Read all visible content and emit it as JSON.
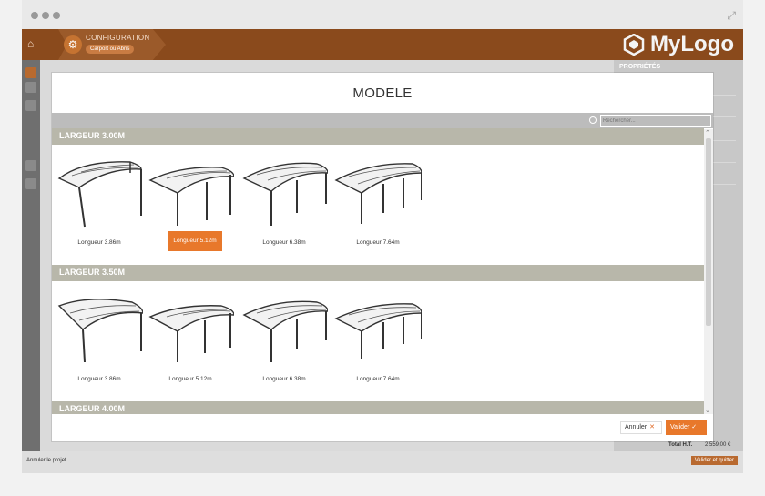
{
  "app": {
    "breadcrumb_title": "CONFIGURATION",
    "breadcrumb_sub": "Carport ou Abris",
    "logo": "MyLogo"
  },
  "modal": {
    "title": "MODELE",
    "search_placeholder": "Rechercher...",
    "sections": [
      {
        "title": "LARGEUR 3.00M",
        "items": [
          {
            "label": "Longueur 3.86m"
          },
          {
            "label": "Longueur 5.12m"
          },
          {
            "label": "Longueur 6.38m"
          },
          {
            "label": "Longueur 7.64m"
          }
        ]
      },
      {
        "title": "LARGEUR 3.50M",
        "items": [
          {
            "label": "Longueur 3.86m"
          },
          {
            "label": "Longueur 5.12m"
          },
          {
            "label": "Longueur 6.38m"
          },
          {
            "label": "Longueur 7.64m"
          }
        ]
      },
      {
        "title": "LARGEUR 4.00M"
      }
    ],
    "cancel_label": "Annuler",
    "validate_label": "Valider"
  },
  "right_panel": {
    "title": "PROPRIÉTÉS",
    "total_label": "Total H.T.",
    "total_value": "2 559,00 €"
  },
  "bottom": {
    "left_label": "Annuler le projet",
    "right_label": "Valider et quitter"
  },
  "colors": {
    "accent": "#e8782b",
    "brand": "#8a4a1c",
    "section": "#b8b7aa"
  },
  "icons": [
    "home-icon",
    "gear-icon",
    "search-icon",
    "cancel-x-icon",
    "check-icon",
    "expand-icon"
  ]
}
